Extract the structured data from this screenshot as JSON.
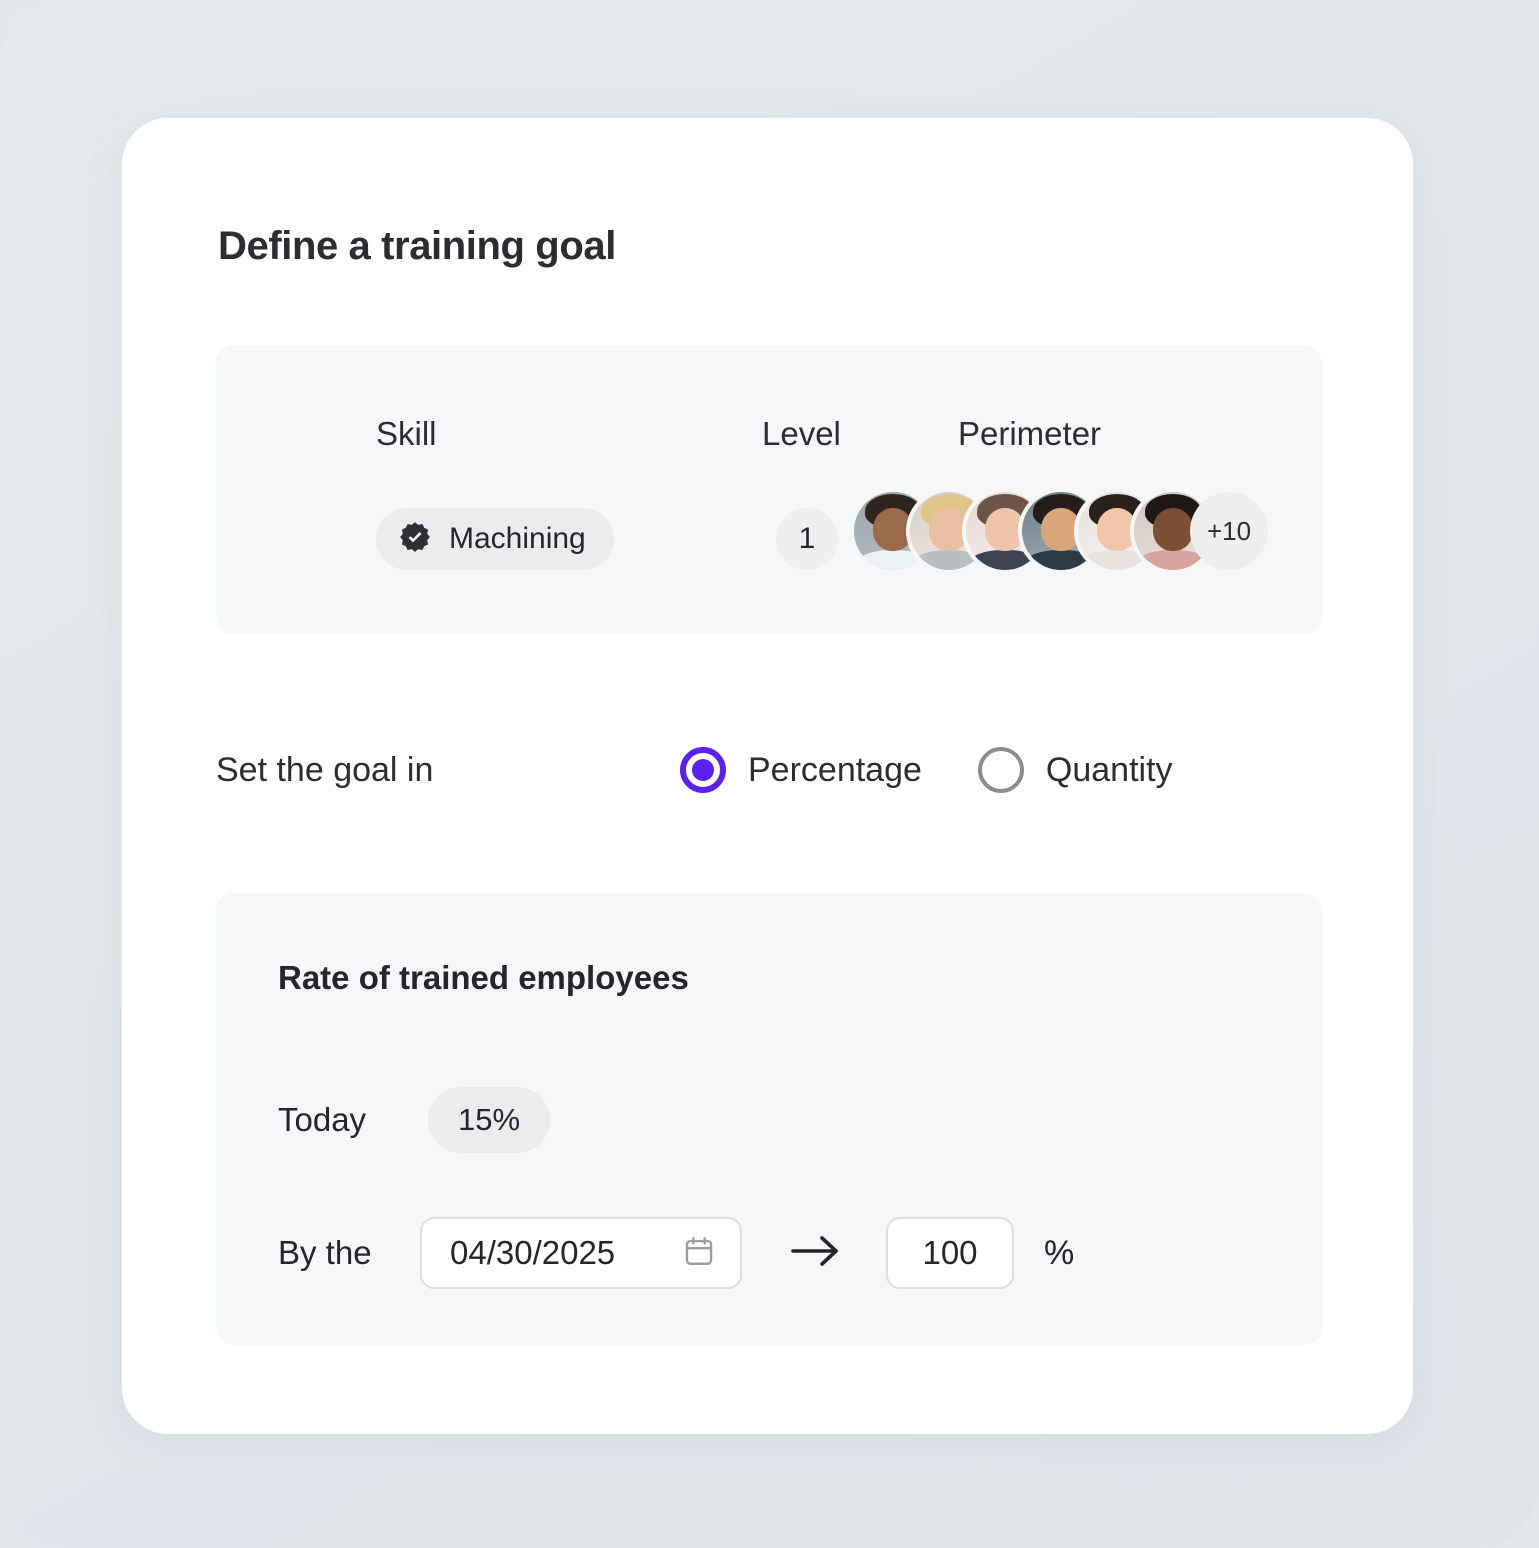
{
  "page": {
    "title": "Define a training goal",
    "accent_color": "#5b21f2",
    "panel_bg": "#f6f7f9",
    "card_bg": "#ffffff",
    "backdrop_bg": "#e4e8ed"
  },
  "skill_panel": {
    "headers": {
      "skill": "Skill",
      "level": "Level",
      "perimeter": "Perimeter"
    },
    "skill_chip": {
      "label": "Machining",
      "icon": "verified-badge-icon"
    },
    "level": "1",
    "perimeter": {
      "avatar_count": 6,
      "more_label": "+10"
    }
  },
  "goal_type": {
    "label": "Set the goal in",
    "options": [
      {
        "label": "Percentage",
        "selected": true
      },
      {
        "label": "Quantity",
        "selected": false
      }
    ]
  },
  "rate_panel": {
    "title": "Rate of trained employees",
    "today": {
      "label": "Today",
      "value": "15%"
    },
    "target": {
      "label": "By the",
      "date": "04/30/2025",
      "date_icon": "calendar-icon",
      "arrow_icon": "arrow-right-icon",
      "value": "100",
      "unit": "%"
    }
  }
}
